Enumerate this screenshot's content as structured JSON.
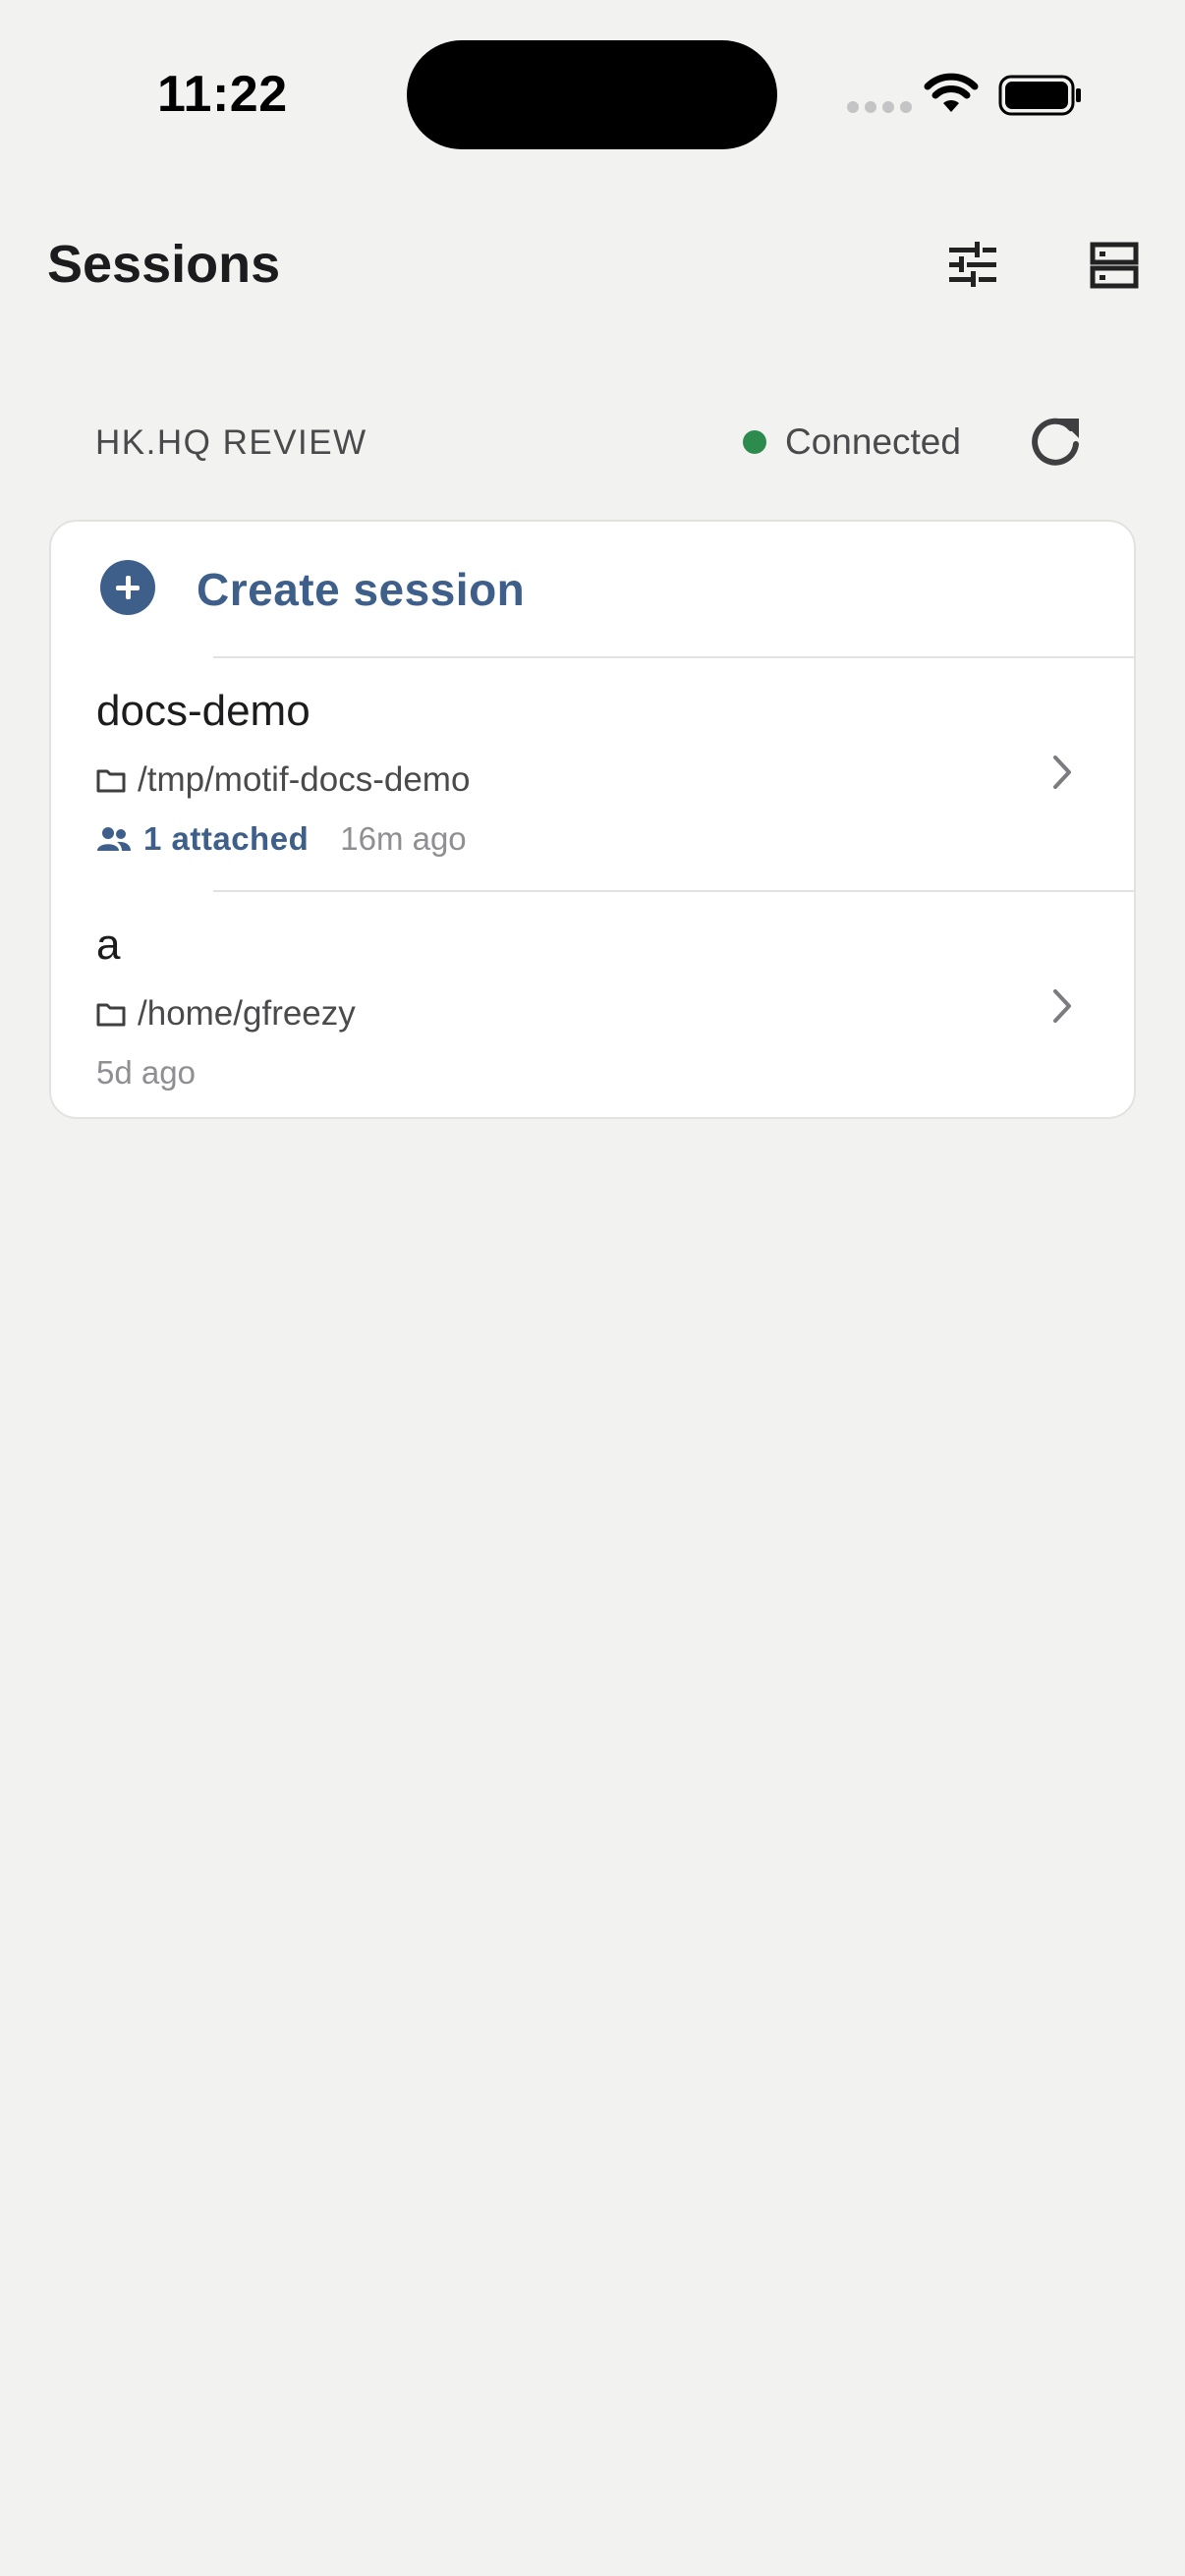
{
  "status_bar": {
    "time": "11:22"
  },
  "nav": {
    "title": "Sessions"
  },
  "server": {
    "name": "HK.HQ REVIEW",
    "status": "Connected",
    "status_color": "#2e8b4e"
  },
  "create": {
    "label": "Create session"
  },
  "sessions": [
    {
      "name": "docs-demo",
      "path": "/tmp/motif-docs-demo",
      "attached": "1 attached",
      "ago": "16m ago"
    },
    {
      "name": "a",
      "path": "/home/gfreezy",
      "ago": "5d ago"
    }
  ],
  "colors": {
    "accent": "#3d5f8a",
    "background": "#f2f2f1"
  },
  "icons": [
    "wifi-icon",
    "battery-icon",
    "tune-icon",
    "servers-icon",
    "refresh-icon",
    "plus-circle-icon",
    "folder-icon",
    "people-icon",
    "chevron-right-icon"
  ]
}
